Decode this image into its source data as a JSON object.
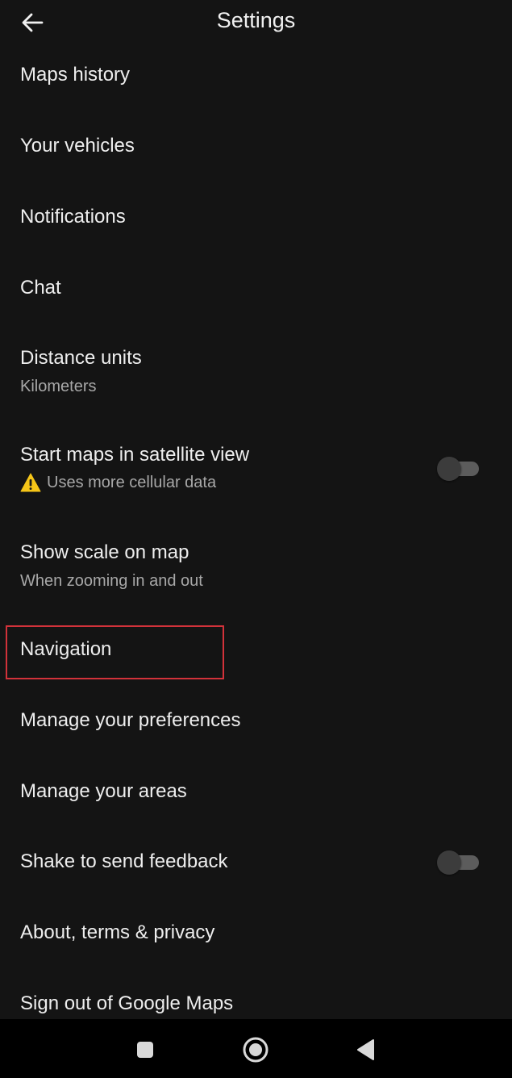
{
  "header": {
    "title": "Settings",
    "back_icon": "arrow-left-icon"
  },
  "settings": {
    "maps_history": {
      "label": "Maps history"
    },
    "your_vehicles": {
      "label": "Your vehicles"
    },
    "notifications": {
      "label": "Notifications"
    },
    "chat": {
      "label": "Chat"
    },
    "distance_units": {
      "label": "Distance units",
      "value": "Kilometers"
    },
    "satellite_view": {
      "label": "Start maps in satellite view",
      "subtext": "Uses more cellular data",
      "warning_icon": "warning-icon",
      "toggle_on": false
    },
    "show_scale": {
      "label": "Show scale on map",
      "subtext": "When zooming in and out"
    },
    "navigation": {
      "label": "Navigation",
      "highlighted": true
    },
    "manage_preferences": {
      "label": "Manage your preferences"
    },
    "manage_areas": {
      "label": "Manage your areas"
    },
    "shake_feedback": {
      "label": "Shake to send feedback",
      "toggle_on": false
    },
    "about": {
      "label": "About, terms & privacy"
    },
    "sign_out": {
      "label": "Sign out of Google Maps"
    }
  },
  "system_nav": {
    "recents_icon": "square-icon",
    "home_icon": "circle-home-icon",
    "back_icon": "triangle-back-icon"
  },
  "colors": {
    "background": "#141414",
    "text_primary": "#eeeeee",
    "text_secondary": "#a8a8a8",
    "highlight_border": "#d2323a",
    "warning_yellow": "#f5c518",
    "toggle_track": "#5c5c5c",
    "toggle_thumb": "#3c3c3c",
    "system_bar": "#000000"
  }
}
